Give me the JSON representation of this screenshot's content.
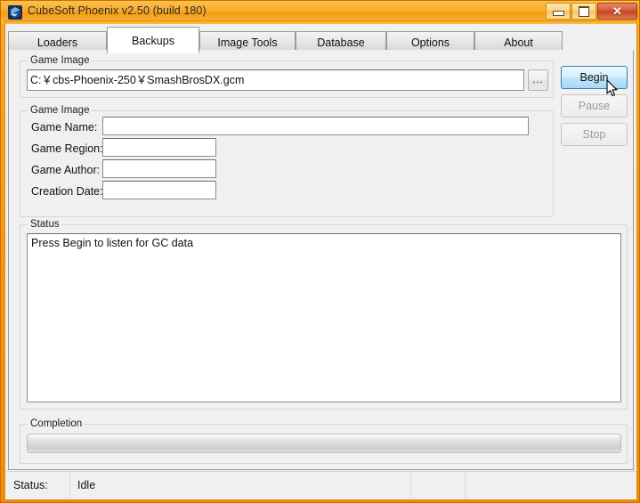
{
  "window": {
    "title": "CubeSoft Phoenix v2.50 (build 180)",
    "icon": "app-cube-icon",
    "accent_color": "#f5a118",
    "client_bg": "#f0f0f0",
    "controls": {
      "minimize": "minimize-icon",
      "maximize": "maximize-icon",
      "close": "✕"
    }
  },
  "tabs": [
    {
      "label": "Loaders",
      "active": false
    },
    {
      "label": "Backups",
      "active": true
    },
    {
      "label": "Image Tools",
      "active": false
    },
    {
      "label": "Database",
      "active": false
    },
    {
      "label": "Options",
      "active": false
    },
    {
      "label": "About",
      "active": false
    }
  ],
  "game_image_group": {
    "legend": "Game Image",
    "path_value": "C:￥cbs-Phoenix-250￥SmashBrosDX.gcm",
    "path_placeholder": "",
    "browse_label": "..."
  },
  "game_info_group": {
    "legend": "Game Image",
    "fields": [
      {
        "label": "Game Name:",
        "value": "",
        "placeholder": ""
      },
      {
        "label": "Game Region:",
        "value": "",
        "placeholder": ""
      },
      {
        "label": "Game Author:",
        "value": "",
        "placeholder": ""
      },
      {
        "label": "Creation Date:",
        "value": "",
        "placeholder": ""
      }
    ]
  },
  "actions": {
    "begin": {
      "label": "Begin",
      "state": "hover"
    },
    "pause": {
      "label": "Pause",
      "state": "disabled"
    },
    "stop": {
      "label": "Stop",
      "state": "disabled"
    }
  },
  "status_group": {
    "legend": "Status",
    "log_text": "Press Begin to listen for GC data"
  },
  "completion_group": {
    "legend": "Completion",
    "percent": 0
  },
  "statusbar": {
    "label": "Status:",
    "value": "Idle",
    "cell3": "",
    "cell4": ""
  }
}
